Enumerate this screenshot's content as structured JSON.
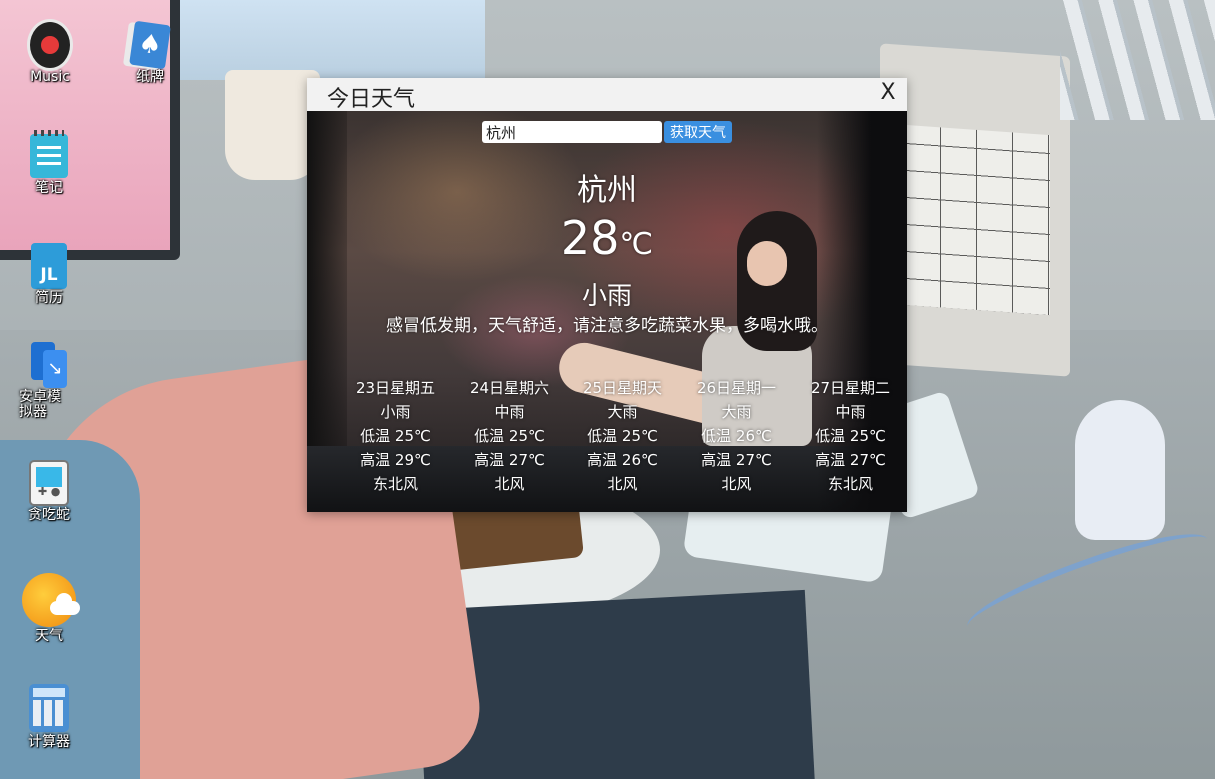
{
  "desktop": {
    "icons": [
      {
        "label": "Music",
        "icon": "music-disc-icon"
      },
      {
        "label": "纸牌",
        "icon": "playing-cards-icon"
      },
      {
        "label": "笔记",
        "icon": "notepad-icon"
      },
      {
        "label": "简历",
        "icon": "resume-jl-icon"
      },
      {
        "label": "安卓模\n拟器",
        "icon": "android-emulator-icon"
      },
      {
        "label": "贪吃蛇",
        "icon": "game-console-icon"
      },
      {
        "label": "天气",
        "icon": "weather-sun-cloud-icon"
      },
      {
        "label": "计算器",
        "icon": "calculator-icon"
      }
    ]
  },
  "weather_window": {
    "title": "今日天气",
    "close_label": "X",
    "search": {
      "value": "杭州",
      "button_label": "获取天气"
    },
    "current": {
      "city": "杭州",
      "temperature": "28",
      "unit": "℃",
      "condition": "小雨",
      "tip": "感冒低发期，天气舒适，请注意多吃蔬菜水果，多喝水哦。"
    },
    "forecast": [
      {
        "date": "23日星期五",
        "weather": "小雨",
        "low": "低温 25℃",
        "high": "高温 29℃",
        "wind": "东北风"
      },
      {
        "date": "24日星期六",
        "weather": "中雨",
        "low": "低温 25℃",
        "high": "高温 27℃",
        "wind": "北风"
      },
      {
        "date": "25日星期天",
        "weather": "大雨",
        "low": "低温 25℃",
        "high": "高温 26℃",
        "wind": "北风"
      },
      {
        "date": "26日星期一",
        "weather": "大雨",
        "low": "低温 26℃",
        "high": "高温 27℃",
        "wind": "北风"
      },
      {
        "date": "27日星期二",
        "weather": "中雨",
        "low": "低温 25℃",
        "high": "高温 27℃",
        "wind": "东北风"
      }
    ]
  },
  "colors": {
    "titlebar_bg": "#f2f2f2",
    "button_bg": "#3a8fe0",
    "text_on_image": "#ffffff"
  }
}
